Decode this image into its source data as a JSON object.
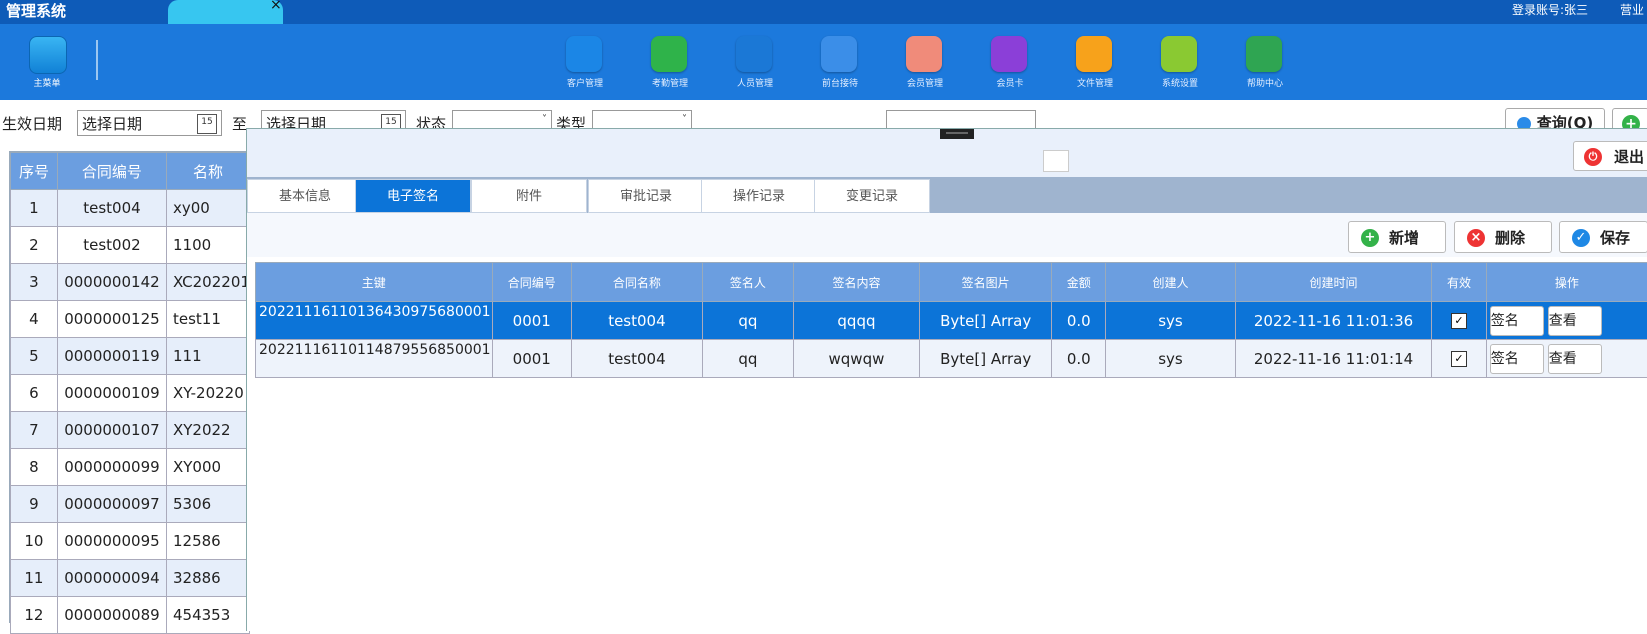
{
  "app": {
    "title": "管理系统",
    "tab_close": "×",
    "login_account": "登录账号:张三",
    "business": "营业"
  },
  "toolbar": {
    "home_label": "主菜单",
    "items": [
      {
        "label": "客户管理",
        "color": "#1b86e6"
      },
      {
        "label": "考勤管理",
        "color": "#2fb34a"
      },
      {
        "label": "人员管理",
        "color": "#1b78d6"
      },
      {
        "label": "前台接待",
        "color": "#3b8ee8"
      },
      {
        "label": "会员管理",
        "color": "#f08b7a"
      },
      {
        "label": "会员卡",
        "color": "#8b3fd8"
      },
      {
        "label": "文件管理",
        "color": "#f7a21b"
      },
      {
        "label": "系统设置",
        "color": "#8ac932"
      },
      {
        "label": "帮助中心",
        "color": "#2fa552"
      }
    ]
  },
  "filters": {
    "effective_date_label": "生效日期",
    "date_placeholder": "选择日期",
    "to_label": "至",
    "status_label": "状态",
    "type_label": "类型",
    "query_button": "查询(Q)"
  },
  "left_table": {
    "columns": [
      "序号",
      "合同编号",
      "名称"
    ],
    "rows": [
      [
        "1",
        "test004",
        "xy00"
      ],
      [
        "2",
        "test002",
        "1100"
      ],
      [
        "3",
        "0000000142",
        "XC202201"
      ],
      [
        "4",
        "0000000125",
        "test11"
      ],
      [
        "5",
        "0000000119",
        "111"
      ],
      [
        "6",
        "0000000109",
        "XY-20220"
      ],
      [
        "7",
        "0000000107",
        "XY2022"
      ],
      [
        "8",
        "0000000099",
        "XY000"
      ],
      [
        "9",
        "0000000097",
        "5306"
      ],
      [
        "10",
        "0000000095",
        "12586"
      ],
      [
        "11",
        "0000000094",
        "32886"
      ],
      [
        "12",
        "0000000089",
        "454353"
      ]
    ]
  },
  "modal": {
    "exit_button": "退出",
    "tabs": [
      "基本信息",
      "电子签名",
      "附件",
      "审批记录",
      "操作记录",
      "变更记录"
    ],
    "active_tab": 1,
    "buttons": {
      "add": "新增",
      "delete": "删除",
      "save": "保存"
    },
    "grid": {
      "columns": [
        "主键",
        "合同编号",
        "合同名称",
        "签名人",
        "签名内容",
        "签名图片",
        "金额",
        "创建人",
        "创建时间",
        "有效",
        "操作"
      ],
      "rows": [
        {
          "id": "20221116110136430975680001",
          "code": "0001",
          "name": "test004",
          "signer": "qq",
          "content": "qqqq",
          "image": "Byte[] Array",
          "amount": "0.0",
          "creator": "sys",
          "time": "2022-11-16 11:01:36",
          "valid": true,
          "selected": true
        },
        {
          "id": "20221116110114879556850001",
          "code": "0001",
          "name": "test004",
          "signer": "qq",
          "content": "wqwqw",
          "image": "Byte[] Array",
          "amount": "0.0",
          "creator": "sys",
          "time": "2022-11-16 11:01:14",
          "valid": true,
          "selected": false
        }
      ],
      "sign_button": "签名",
      "view_button": "查看"
    }
  }
}
